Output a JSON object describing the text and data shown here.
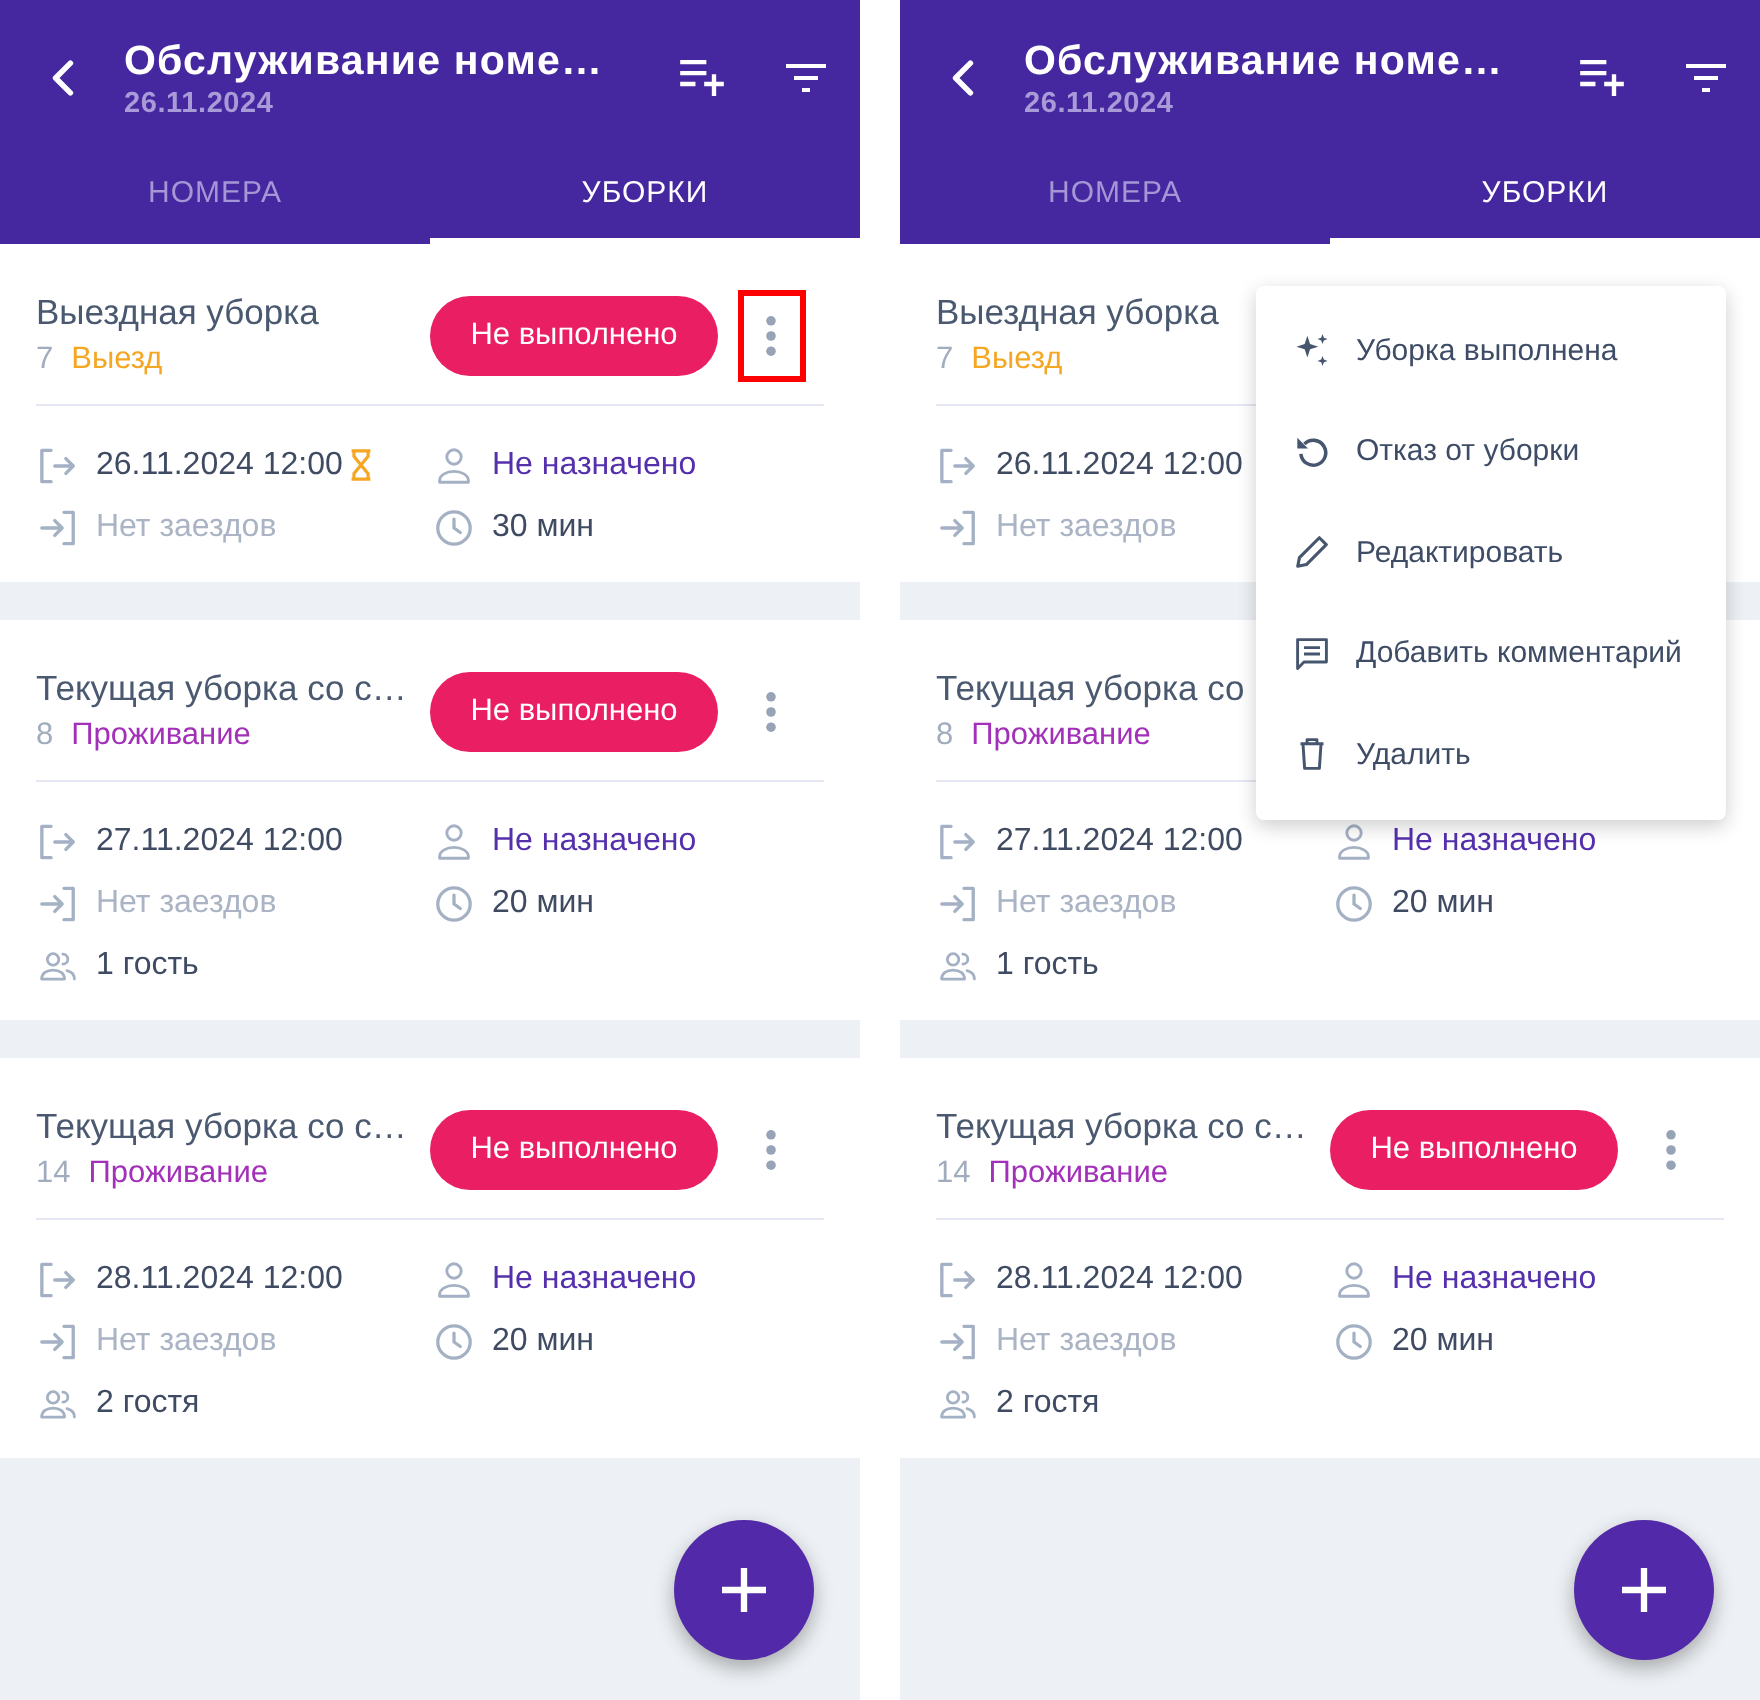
{
  "screens": [
    {
      "app_bar": {
        "title": "Обслуживание номе…",
        "date": "26.11.2024"
      },
      "tabs": [
        {
          "label": "НОМЕРА",
          "selected": false
        },
        {
          "label": "УБОРКИ",
          "selected": true
        }
      ],
      "cards": [
        {
          "title": "Выездная уборка",
          "number": "7",
          "category": {
            "label": "Выезд",
            "color": "#f5a623"
          },
          "status": "Не выполнено",
          "more": {
            "highlighted": true
          },
          "details": [
            {
              "kind": "departure",
              "text": "26.11.2024 12:00",
              "overdue": true
            },
            {
              "kind": "assignee",
              "text": "Не назначено"
            },
            {
              "kind": "arrival",
              "text": "Нет заездов"
            },
            {
              "kind": "duration",
              "text": "30 мин"
            }
          ]
        },
        {
          "title": "Текущая уборка со с…",
          "number": "8",
          "category": {
            "label": "Проживание",
            "color": "#a330b8"
          },
          "status": "Не выполнено",
          "more": {
            "highlighted": false
          },
          "details": [
            {
              "kind": "departure",
              "text": "27.11.2024 12:00",
              "overdue": false
            },
            {
              "kind": "assignee",
              "text": "Не назначено"
            },
            {
              "kind": "arrival",
              "text": "Нет заездов"
            },
            {
              "kind": "duration",
              "text": "20 мин"
            },
            {
              "kind": "guests",
              "text": "1 гость"
            }
          ]
        },
        {
          "title": "Текущая уборка со с…",
          "number": "14",
          "category": {
            "label": "Проживание",
            "color": "#a330b8"
          },
          "status": "Не выполнено",
          "more": {
            "highlighted": false
          },
          "details": [
            {
              "kind": "departure",
              "text": "28.11.2024 12:00",
              "overdue": false
            },
            {
              "kind": "assignee",
              "text": "Не назначено"
            },
            {
              "kind": "arrival",
              "text": "Нет заездов"
            },
            {
              "kind": "duration",
              "text": "20 мин"
            },
            {
              "kind": "guests",
              "text": "2 гостя"
            }
          ]
        }
      ]
    },
    {
      "app_bar": {
        "title": "Обслуживание номе…",
        "date": "26.11.2024"
      },
      "tabs": [
        {
          "label": "НОМЕРА",
          "selected": false
        },
        {
          "label": "УБОРКИ",
          "selected": true
        }
      ],
      "cards": [
        {
          "title": "Выездная уборка",
          "number": "7",
          "category": {
            "label": "Выезд",
            "color": "#f5a623"
          },
          "details": [
            {
              "kind": "departure",
              "text": "26.11.2024 12:00"
            },
            {
              "kind": "arrival",
              "text": "Нет заездов"
            }
          ]
        },
        {
          "title": "Текущая уборка со",
          "number": "8",
          "category": {
            "label": "Проживание",
            "color": "#a330b8"
          },
          "details": [
            {
              "kind": "departure",
              "text": "27.11.2024 12:00",
              "overdue": false
            },
            {
              "kind": "assignee",
              "text": "Не назначено"
            },
            {
              "kind": "arrival",
              "text": "Нет заездов"
            },
            {
              "kind": "duration",
              "text": "20 мин"
            },
            {
              "kind": "guests",
              "text": "1 гость"
            }
          ]
        },
        {
          "title": "Текущая уборка со с…",
          "number": "14",
          "category": {
            "label": "Проживание",
            "color": "#a330b8"
          },
          "status": "Не выполнено",
          "more": {
            "highlighted": false
          },
          "details": [
            {
              "kind": "departure",
              "text": "28.11.2024 12:00",
              "overdue": false
            },
            {
              "kind": "assignee",
              "text": "Не назначено"
            },
            {
              "kind": "arrival",
              "text": "Нет заездов"
            },
            {
              "kind": "duration",
              "text": "20 мин"
            },
            {
              "kind": "guests",
              "text": "2 гостя"
            }
          ]
        }
      ],
      "menu": {
        "items": [
          {
            "kind": "done",
            "label": "Уборка выполнена"
          },
          {
            "kind": "refuse",
            "label": "Отказ от уборки"
          },
          {
            "kind": "edit",
            "label": "Редактировать"
          },
          {
            "kind": "comment",
            "label": "Добавить комментарий"
          },
          {
            "kind": "delete",
            "label": "Удалить"
          }
        ]
      }
    }
  ]
}
